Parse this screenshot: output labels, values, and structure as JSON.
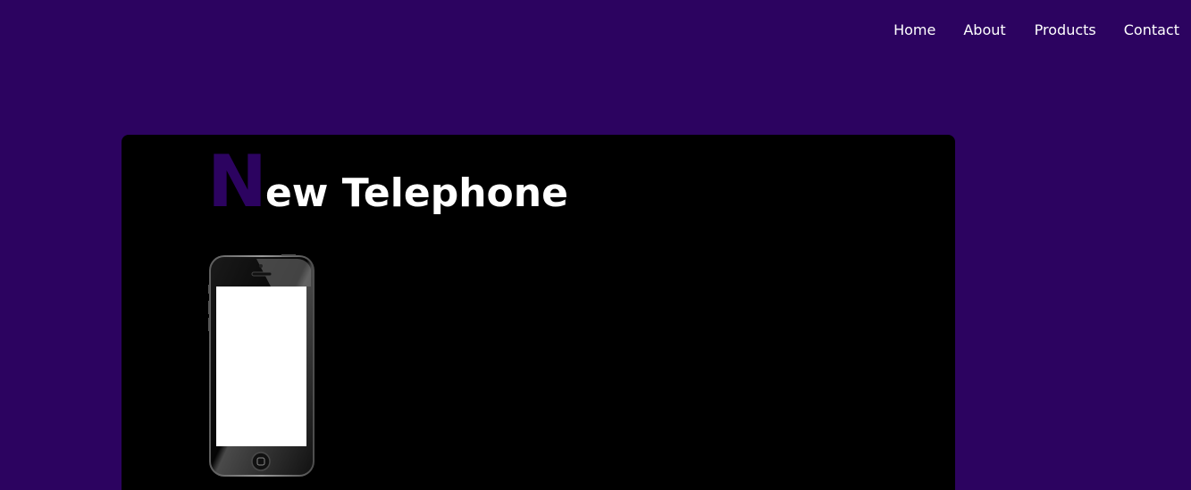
{
  "nav": {
    "items": [
      {
        "label": "Home"
      },
      {
        "label": "About"
      },
      {
        "label": "Products"
      },
      {
        "label": "Contact"
      }
    ]
  },
  "hero": {
    "title_initial": "N",
    "title_rest": "ew Telephone"
  },
  "colors": {
    "background": "#2c0360",
    "panel": "#000000",
    "nav_text": "#ffffff",
    "title_text": "#ffffff",
    "title_initial": "#2c0360"
  },
  "icons": {
    "phone": "smartphone-icon"
  }
}
